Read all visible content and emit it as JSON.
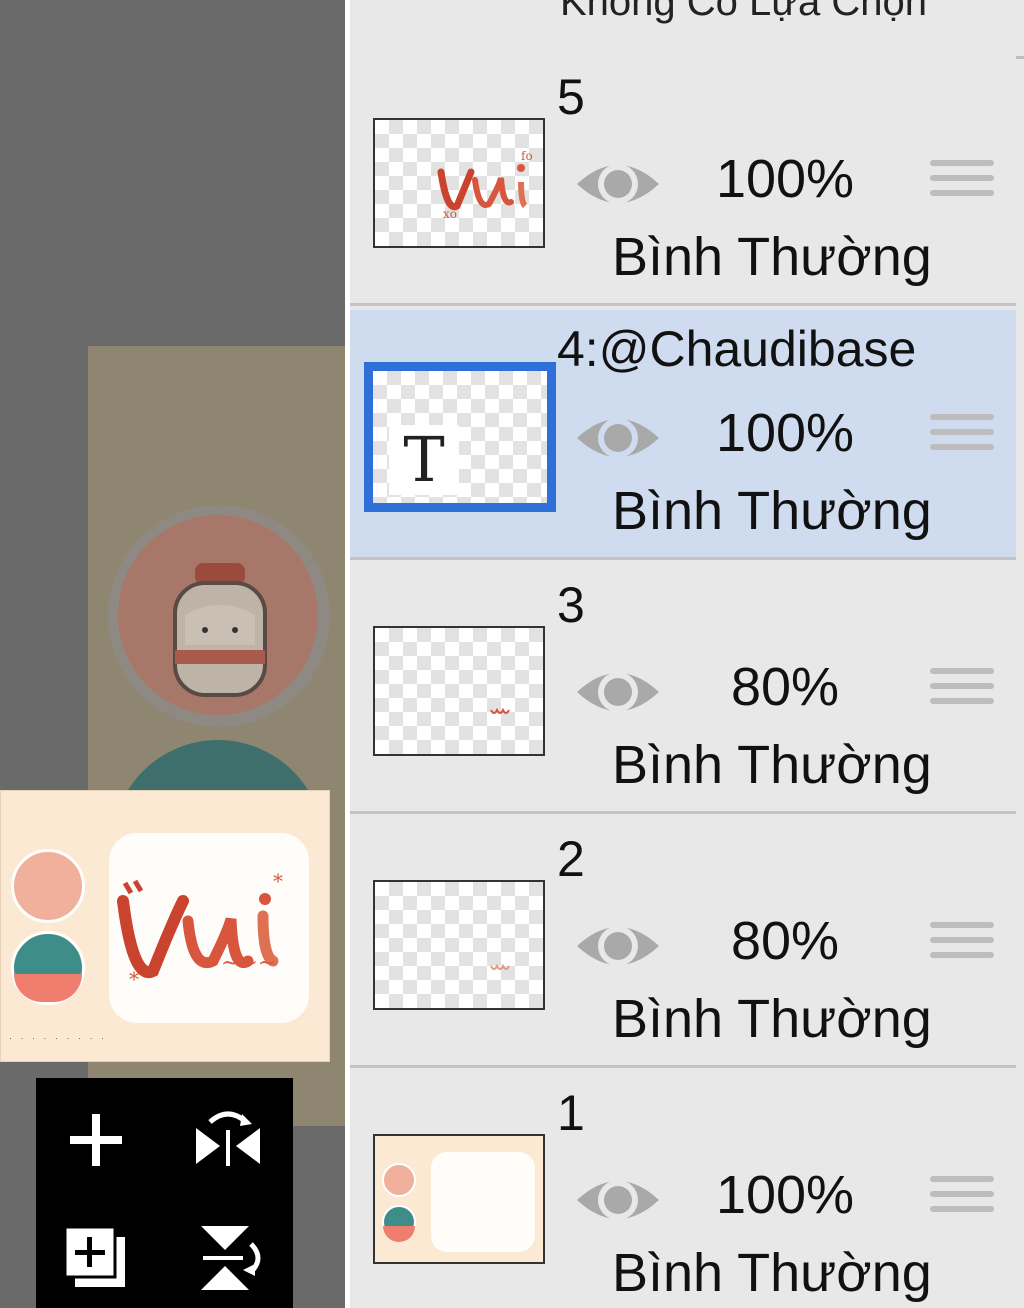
{
  "panel": {
    "header": "Không Có Lựa Chọn"
  },
  "layers": [
    {
      "name": "5",
      "opacity": "100%",
      "blend": "Bình Thường",
      "selected": false,
      "thumb": "vui-lettering"
    },
    {
      "name": "4:@Chaudibase",
      "opacity": "100%",
      "blend": "Bình Thường",
      "selected": true,
      "thumb": "text-layer"
    },
    {
      "name": "3",
      "opacity": "80%",
      "blend": "Bình Thường",
      "selected": false,
      "thumb": "small-text"
    },
    {
      "name": "2",
      "opacity": "80%",
      "blend": "Bình Thường",
      "selected": false,
      "thumb": "small-text"
    },
    {
      "name": "1",
      "opacity": "100%",
      "blend": "Bình Thường",
      "selected": false,
      "thumb": "background-frame"
    }
  ],
  "icons": {
    "visibility": "eye-icon",
    "reorder": "drag-handle-icon",
    "add_layer": "plus-icon",
    "flip_horizontal": "flip-horizontal-icon",
    "add_copy": "add-copy-icon",
    "flip_vertical": "flip-vertical-icon"
  },
  "colors": {
    "selected_row": "#cfdcef",
    "selected_border": "#2e6fd8",
    "panel_bg": "#e8e8e8",
    "canvas_bg": "#6a6a6a",
    "lettering": "#d8553e"
  }
}
